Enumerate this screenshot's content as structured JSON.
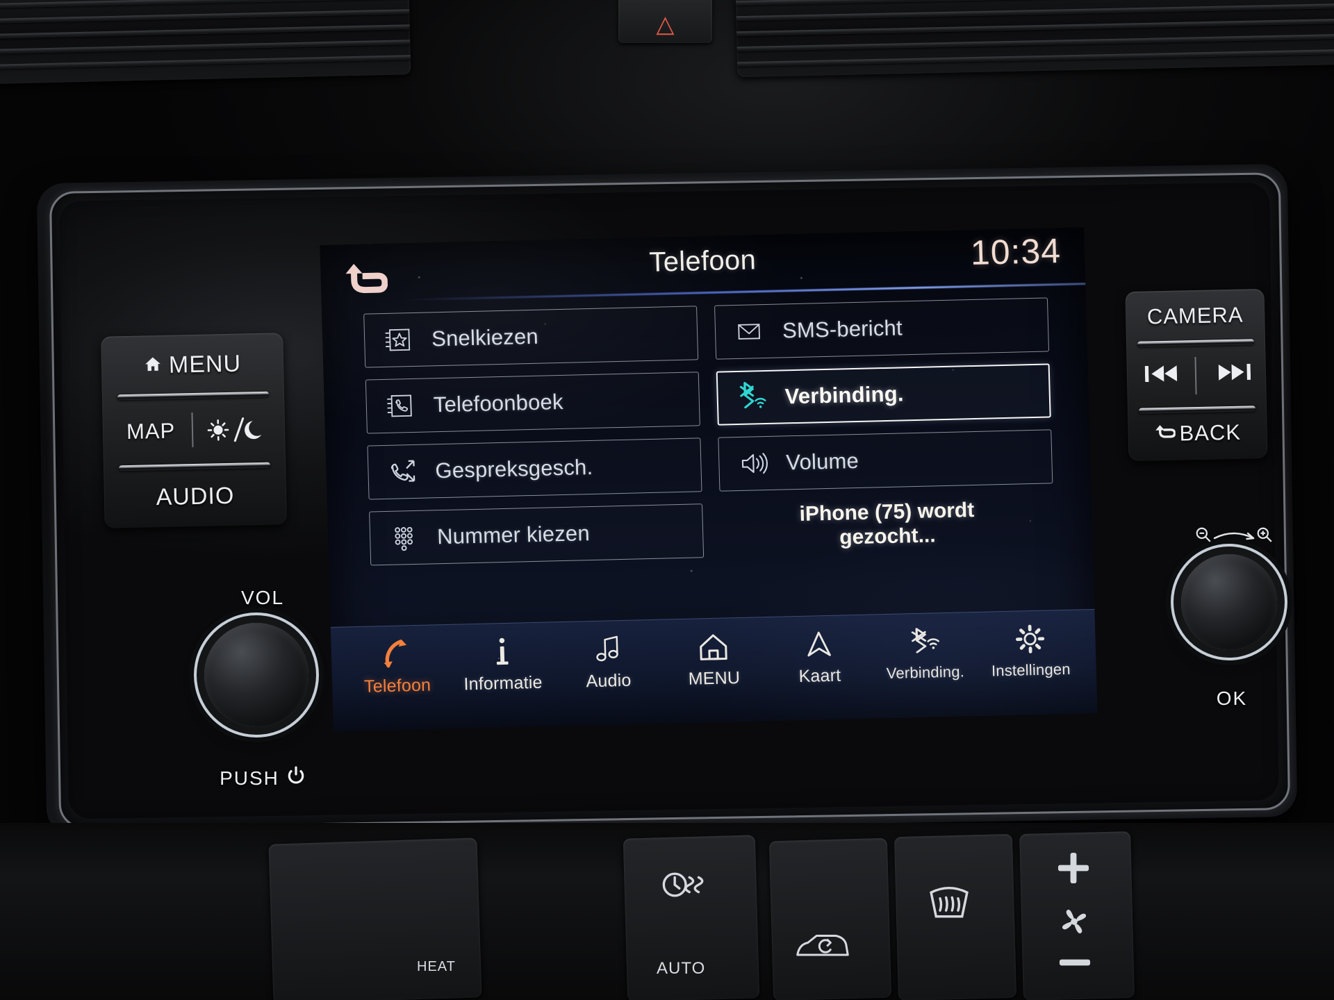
{
  "screen": {
    "title": "Telefoon",
    "clock": "10:34",
    "back_icon": "back-arrow-icon",
    "tiles_left": [
      {
        "label": "Snelkiezen",
        "icon": "speed-dial-star-icon",
        "selected": false
      },
      {
        "label": "Telefoonboek",
        "icon": "phonebook-icon",
        "selected": false
      },
      {
        "label": "Gespreksgesch.",
        "icon": "call-history-icon",
        "selected": false
      },
      {
        "label": "Nummer kiezen",
        "icon": "dialpad-icon",
        "selected": false
      }
    ],
    "tiles_right": [
      {
        "label": "SMS-bericht",
        "icon": "envelope-icon",
        "selected": false
      },
      {
        "label": "Verbinding.",
        "icon": "bluetooth-wifi-icon",
        "selected": true
      },
      {
        "label": "Volume",
        "icon": "speaker-volume-icon",
        "selected": false
      }
    ],
    "status_line1": "iPhone (75) wordt",
    "status_line2": "gezocht...",
    "navbar": [
      {
        "label": "Telefoon",
        "icon": "phone-handset-icon",
        "active": true,
        "small": false
      },
      {
        "label": "Informatie",
        "icon": "info-i-icon",
        "active": false,
        "small": false
      },
      {
        "label": "Audio",
        "icon": "music-note-icon",
        "active": false,
        "small": false
      },
      {
        "label": "MENU",
        "icon": "home-house-icon",
        "active": false,
        "small": false
      },
      {
        "label": "Kaart",
        "icon": "navigation-arrow-icon",
        "active": false,
        "small": false
      },
      {
        "label": "Verbinding.",
        "icon": "bluetooth-wifi-icon",
        "active": false,
        "small": true
      },
      {
        "label": "Instellingen",
        "icon": "gear-settings-icon",
        "active": false,
        "small": true
      }
    ],
    "accent_selected": "#ffffff",
    "accent_active_tab": "#f4803c",
    "accent_bluetooth": "#2fd7d2"
  },
  "hard_buttons_left": {
    "menu_label": "MENU",
    "menu_icon": "home-house-icon",
    "map_label": "MAP",
    "daynight_icon": "sun-moon-icon",
    "audio_label": "AUDIO"
  },
  "hard_buttons_right": {
    "camera_label": "CAMERA",
    "prev_icon": "skip-previous-icon",
    "next_icon": "skip-next-icon",
    "back_label": "BACK",
    "back_icon": "back-arrow-icon"
  },
  "vol_knob": {
    "top_label": "VOL",
    "bottom_label": "PUSH",
    "power_icon": "power-icon"
  },
  "ok_knob": {
    "bottom_label": "OK",
    "zoom_out_icon": "zoom-out-icon",
    "zoom_in_icon": "zoom-in-icon"
  },
  "hazard": {
    "icon": "hazard-triangle-icon"
  },
  "climate": {
    "auto_label": "AUTO",
    "heat_label": "HEAT",
    "seat_heat_icon": "seat-heater-icon",
    "recirculate_icon": "air-recirculation-icon",
    "rear_defrost_icon": "rear-defrost-icon",
    "fan_up_icon": "plus-icon",
    "fan_icon": "fan-icon",
    "fan_down_icon": "minus-icon"
  }
}
